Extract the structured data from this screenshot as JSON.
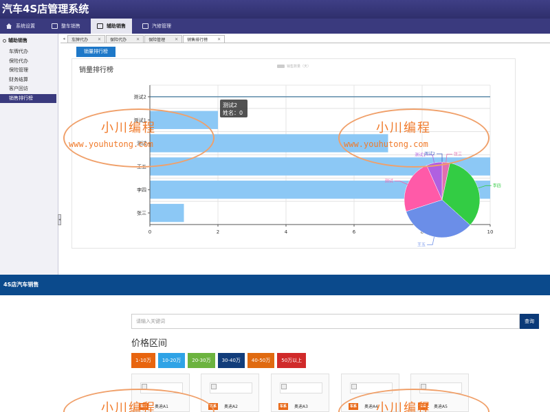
{
  "app": {
    "title": "汽车4S店管理系统"
  },
  "topnav": [
    {
      "label": "系统设置",
      "icon": "home-icon",
      "active": false
    },
    {
      "label": "整车销售",
      "icon": "window-icon",
      "active": false
    },
    {
      "label": "辅助销售",
      "icon": "window-icon",
      "active": true
    },
    {
      "label": "汽修管理",
      "icon": "window-icon",
      "active": false
    }
  ],
  "sidebar": {
    "title": "辅助销售",
    "items": [
      {
        "label": "车牌代办",
        "active": false
      },
      {
        "label": "保险代办",
        "active": false
      },
      {
        "label": "保险管理",
        "active": false
      },
      {
        "label": "财务结算",
        "active": false
      },
      {
        "label": "客户回访",
        "active": false
      },
      {
        "label": "销售排行榜",
        "active": true
      }
    ]
  },
  "tabs": [
    {
      "label": "车牌代办",
      "active": false
    },
    {
      "label": "保险代办",
      "active": false
    },
    {
      "label": "保险管理",
      "active": false
    },
    {
      "label": "销售排行榜",
      "active": true
    }
  ],
  "content": {
    "button_label": "销量排行榜"
  },
  "chart_data": [
    {
      "type": "bar",
      "orientation": "horizontal",
      "title": "销量排行榜",
      "legend": {
        "position": "top",
        "entries": [
          "销售数量（天）"
        ]
      },
      "categories": [
        "测试2",
        "测试1",
        "测试",
        "王五",
        "李四",
        "张三"
      ],
      "values": [
        0,
        2,
        7,
        10,
        10,
        1
      ],
      "xlim": [
        0,
        10
      ],
      "xticks": [
        0,
        2,
        4,
        6,
        8,
        10
      ],
      "grid": true,
      "bar_color": "#8cc8f5",
      "tooltip": {
        "title": "测试2",
        "line": "姓名：0"
      }
    },
    {
      "type": "pie",
      "slices": [
        {
          "name": "张三",
          "value": 1,
          "color": "#e070b0"
        },
        {
          "name": "李四",
          "value": 10,
          "color": "#33cc44"
        },
        {
          "name": "王五",
          "value": 10,
          "color": "#6b8ee8"
        },
        {
          "name": "测试",
          "value": 7,
          "color": "#ff5aa8"
        },
        {
          "name": "测试1",
          "value": 2,
          "color": "#b060e0"
        },
        {
          "name": "测试2",
          "value": 0,
          "color": "#4060c0"
        }
      ]
    }
  ],
  "watermark": {
    "text_cn": "小川编程",
    "text_url": "www.youhutong.com",
    "color": "#f07a2a"
  },
  "site": {
    "title": "4S店汽车销售",
    "search_placeholder": "请输入关键词",
    "search_button": "查询",
    "price_heading": "价格区间",
    "price_ranges": [
      {
        "label": "1-10万",
        "color": "#e8650f"
      },
      {
        "label": "10-20万",
        "color": "#2fa3e6"
      },
      {
        "label": "20-30万",
        "color": "#6cb33f"
      },
      {
        "label": "30-40万",
        "color": "#123d7a"
      },
      {
        "label": "40-50万",
        "color": "#e06a10"
      },
      {
        "label": "50万以上",
        "color": "#d02a2a"
      }
    ],
    "cars": [
      {
        "badge": "车系",
        "name": "奥迪A1"
      },
      {
        "badge": "车系",
        "name": "奥迪A2"
      },
      {
        "badge": "车系",
        "name": "奥迪A3"
      },
      {
        "badge": "车系",
        "name": "奥迪A4"
      },
      {
        "badge": "车系",
        "name": "奥迪A5"
      }
    ]
  }
}
